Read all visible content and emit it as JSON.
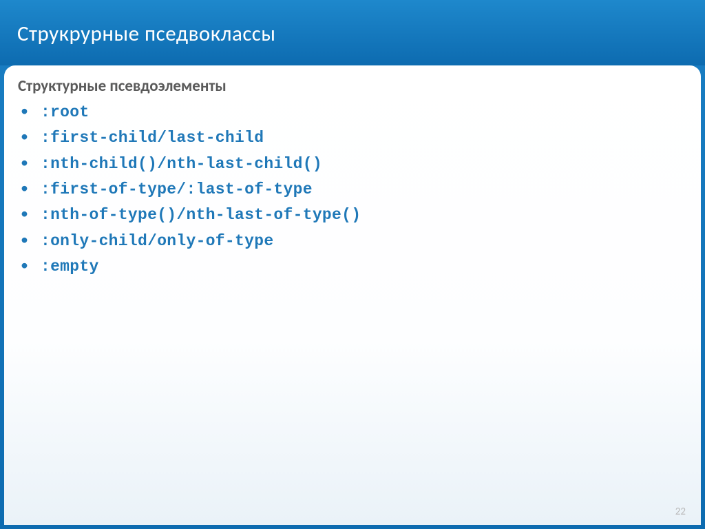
{
  "header": {
    "title": "Струкрурные пседвоклассы"
  },
  "content": {
    "subtitle": "Структурные псевдоэлементы",
    "items": [
      ":root",
      ":first-child/last-child",
      ":nth-child()/nth-last-child()",
      ":first-of-type/:last-of-type",
      ":nth-of-type()/nth-last-of-type()",
      ":only-child/only-of-type",
      ":empty"
    ]
  },
  "page_number": "22"
}
